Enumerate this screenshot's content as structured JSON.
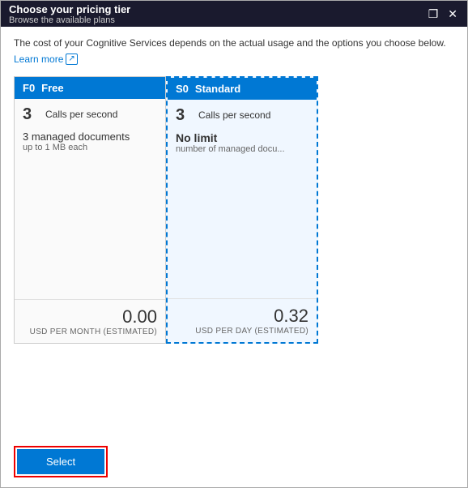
{
  "window": {
    "title": "Choose your pricing tier",
    "subtitle": "Browse the available plans",
    "controls": {
      "restore": "❐",
      "close": "✕"
    }
  },
  "info": {
    "description": "The cost of your Cognitive Services depends on the actual usage and the options you choose below.",
    "learn_more_label": "Learn more",
    "learn_more_icon": "↗"
  },
  "tiers": [
    {
      "code": "F0",
      "name": "Free",
      "selected": false,
      "calls_number": "3",
      "calls_label": "Calls per second",
      "docs_main": "3 managed documents",
      "docs_sub": "up to 1 MB each",
      "no_limit": "",
      "no_limit_sub": "",
      "price": "0.00",
      "price_unit": "USD PER MONTH (ESTIMATED)"
    },
    {
      "code": "S0",
      "name": "Standard",
      "selected": true,
      "calls_number": "3",
      "calls_label": "Calls per second",
      "docs_main": "No limit",
      "docs_sub": "number of managed docu...",
      "price": "0.32",
      "price_unit": "USD PER DAY (ESTIMATED)"
    }
  ],
  "footer": {
    "select_label": "Select"
  }
}
